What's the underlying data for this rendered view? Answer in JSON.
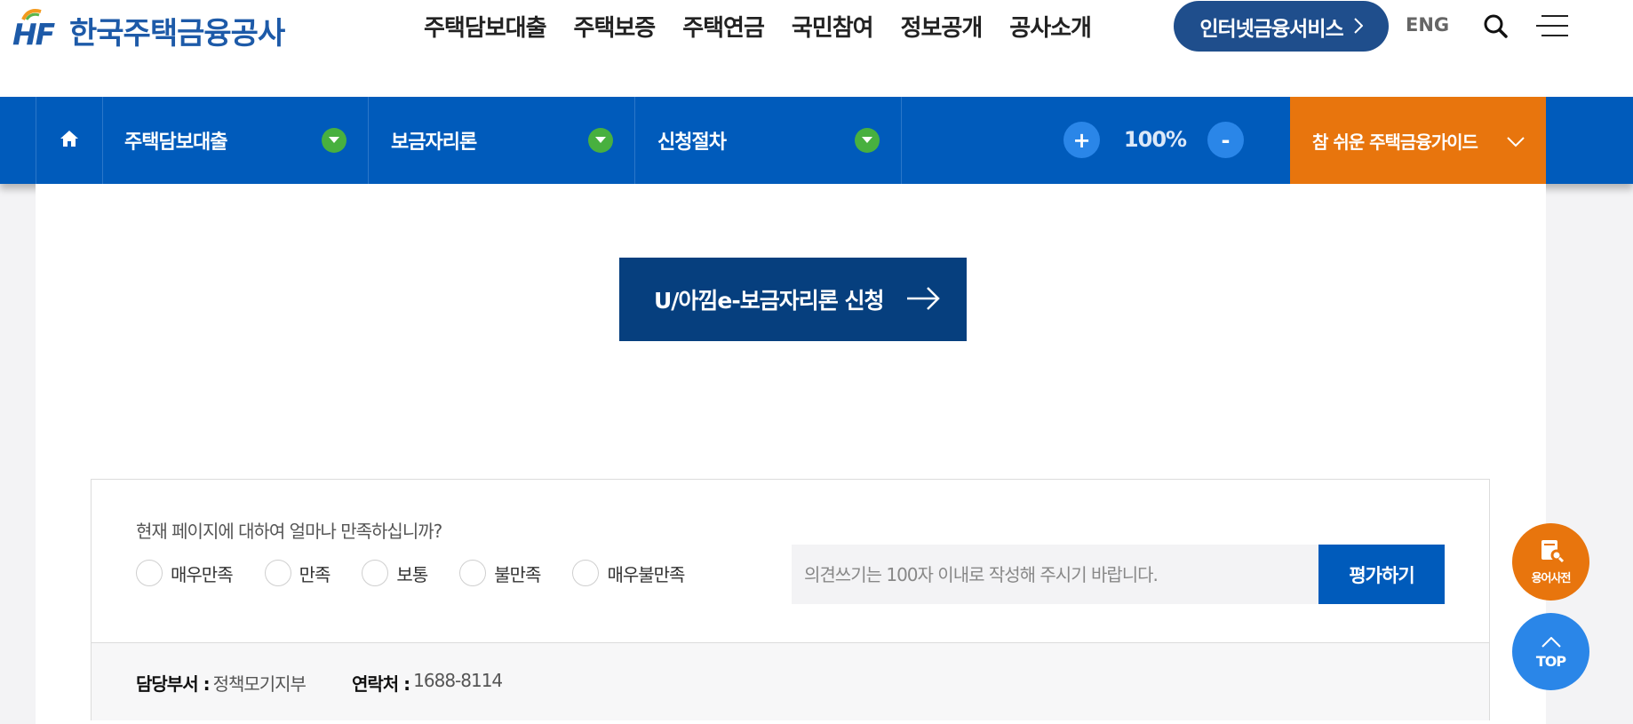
{
  "header": {
    "logo_mark": "HF",
    "logo_text": "한국주택금융공사",
    "gnb": [
      "주택담보대출",
      "주택보증",
      "주택연금",
      "국민참여",
      "정보공개",
      "공사소개"
    ],
    "internet_service": "인터넷금융서비스",
    "eng": "ENG"
  },
  "locbar": {
    "segments": [
      "주택담보대출",
      "보금자리론",
      "신청절차"
    ],
    "zoom_plus": "+",
    "zoom_value": "100%",
    "zoom_minus": "-",
    "guide": "참 쉬운 주택금융가이드"
  },
  "main": {
    "apply_button": "U/아낌e-보금자리론 신청"
  },
  "survey": {
    "question": "현재 페이지에 대하여 얼마나 만족하십니까?",
    "options": [
      "매우만족",
      "만족",
      "보통",
      "불만족",
      "매우불만족"
    ],
    "opinion_placeholder": "의견쓰기는 100자 이내로 작성해 주시기 바랍니다.",
    "submit": "평가하기",
    "dept_label": "담당부서 :",
    "dept_value": "정책모기지부",
    "contact_label": "연락처 :",
    "contact_value": "1688-8114"
  },
  "floating": {
    "dictionary": "용어사전",
    "top": "TOP"
  },
  "colors": {
    "brand_blue": "#005bbb",
    "dark_blue": "#063f7e",
    "orange": "#e8750d",
    "green": "#48b03f"
  }
}
